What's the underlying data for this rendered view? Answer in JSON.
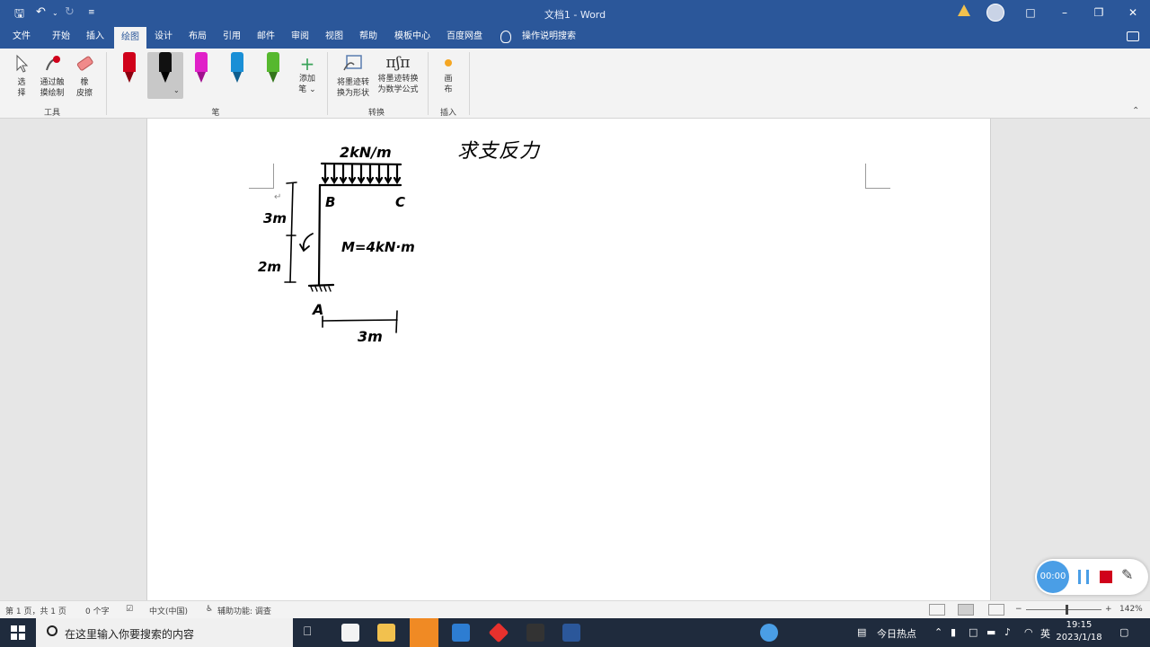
{
  "titlebar": {
    "doc_title": "文档1 - Word",
    "save_icon": "save-icon",
    "undo_icon": "undo-icon",
    "redo_icon": "redo-icon"
  },
  "menu": {
    "tabs": [
      "文件",
      "开始",
      "插入",
      "绘图",
      "设计",
      "布局",
      "引用",
      "邮件",
      "审阅",
      "视图",
      "帮助",
      "模板中心",
      "百度网盘"
    ],
    "active_tab": "绘图",
    "tell_me": "操作说明搜索"
  },
  "ribbon": {
    "tools": {
      "select": "选\n择",
      "touch_draw": "通过触\n摸绘制",
      "eraser": "橡\n皮擦",
      "group_label": "工具"
    },
    "pens": {
      "colors": [
        "#d0021b",
        "#111111",
        "#e020c8",
        "#1a8fd6",
        "#56b82e"
      ],
      "add_pen": "添加\n笔 ⌄",
      "group_label": "笔"
    },
    "convert": {
      "to_shape": "将墨迹转\n换为形状",
      "to_math": "将墨迹转换\n为数学公式",
      "group_label": "转换"
    },
    "insert": {
      "canvas": "画\n布",
      "group_label": "插入"
    }
  },
  "document": {
    "ink_title": "求支反力",
    "diagram": {
      "load_label": "2kN/m",
      "node_b": "B",
      "node_c": "C",
      "node_a": "A",
      "seg_upper": "3m",
      "seg_lower": "2m",
      "moment": "M=4kN·m",
      "span": "3m"
    }
  },
  "recorder": {
    "time": "00:00"
  },
  "status": {
    "page": "第 1 页，共 1 页",
    "words": "0 个字",
    "language": "中文(中国)",
    "accessibility": "辅助功能: 调查",
    "zoom": "142%"
  },
  "taskbar": {
    "search_placeholder": "在这里输入你要搜索的内容",
    "news": "今日热点",
    "ime": "英",
    "time": "19:15",
    "date": "2023/1/18"
  }
}
